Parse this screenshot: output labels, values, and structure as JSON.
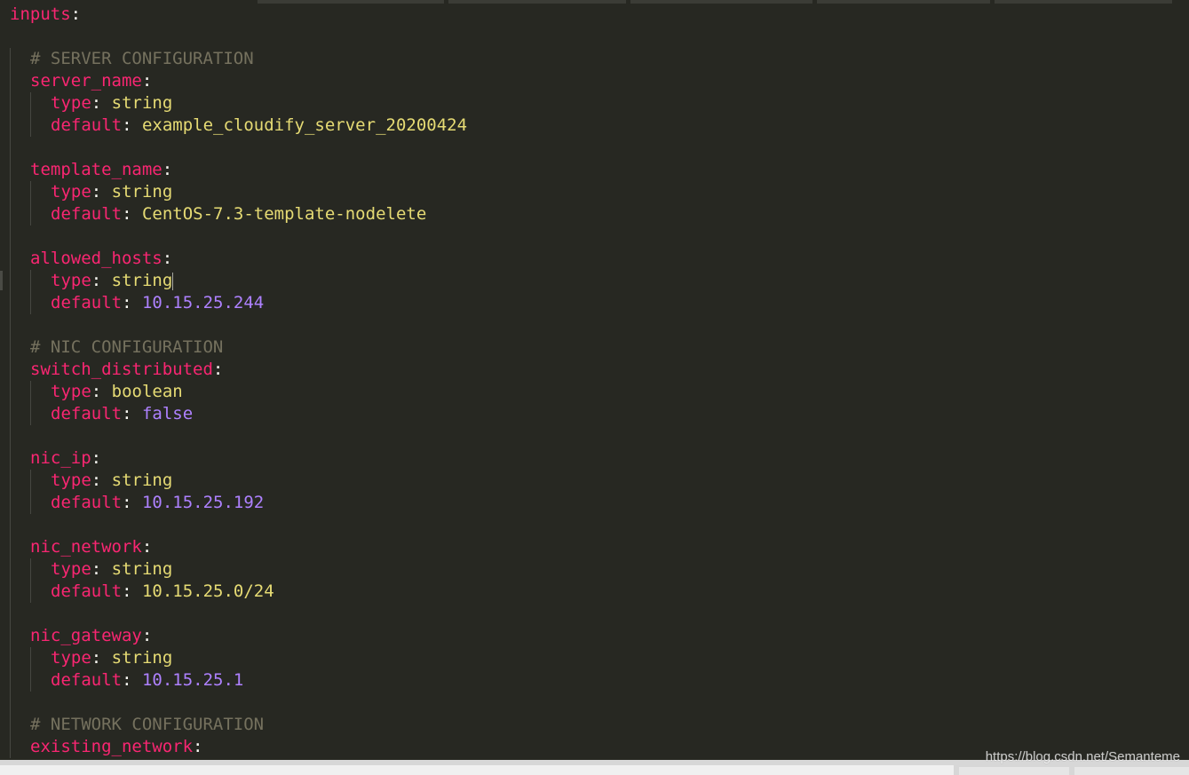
{
  "editor": {
    "lines": [
      {
        "indent": 0,
        "key": "inputs",
        "colon": ":"
      },
      {
        "indent": 0,
        "blank": true
      },
      {
        "indent": 1,
        "comment": "# SERVER CONFIGURATION"
      },
      {
        "indent": 1,
        "key": "server_name",
        "colon": ":"
      },
      {
        "indent": 2,
        "key": "type",
        "colon": ": ",
        "value": "string",
        "vtype": "str"
      },
      {
        "indent": 2,
        "key": "default",
        "colon": ": ",
        "value": "example_cloudify_server_20200424",
        "vtype": "str"
      },
      {
        "indent": 1,
        "blank": true
      },
      {
        "indent": 1,
        "key": "template_name",
        "colon": ":"
      },
      {
        "indent": 2,
        "key": "type",
        "colon": ": ",
        "value": "string",
        "vtype": "str"
      },
      {
        "indent": 2,
        "key": "default",
        "colon": ": ",
        "value": "CentOS-7.3-template-nodelete",
        "vtype": "str"
      },
      {
        "indent": 1,
        "blank": true
      },
      {
        "indent": 1,
        "key": "allowed_hosts",
        "colon": ":"
      },
      {
        "indent": 2,
        "key": "type",
        "colon": ": ",
        "value": "string",
        "vtype": "str",
        "caret": true
      },
      {
        "indent": 2,
        "key": "default",
        "colon": ": ",
        "value": "10.15.25.244",
        "vtype": "num"
      },
      {
        "indent": 1,
        "blank": true
      },
      {
        "indent": 1,
        "comment": "# NIC CONFIGURATION"
      },
      {
        "indent": 1,
        "key": "switch_distributed",
        "colon": ":"
      },
      {
        "indent": 2,
        "key": "type",
        "colon": ": ",
        "value": "boolean",
        "vtype": "str"
      },
      {
        "indent": 2,
        "key": "default",
        "colon": ": ",
        "value": "false",
        "vtype": "num"
      },
      {
        "indent": 1,
        "blank": true
      },
      {
        "indent": 1,
        "key": "nic_ip",
        "colon": ":"
      },
      {
        "indent": 2,
        "key": "type",
        "colon": ": ",
        "value": "string",
        "vtype": "str"
      },
      {
        "indent": 2,
        "key": "default",
        "colon": ": ",
        "value": "10.15.25.192",
        "vtype": "num"
      },
      {
        "indent": 1,
        "blank": true
      },
      {
        "indent": 1,
        "key": "nic_network",
        "colon": ":"
      },
      {
        "indent": 2,
        "key": "type",
        "colon": ": ",
        "value": "string",
        "vtype": "str"
      },
      {
        "indent": 2,
        "key": "default",
        "colon": ": ",
        "value": "10.15.25.0/24",
        "vtype": "str"
      },
      {
        "indent": 1,
        "blank": true
      },
      {
        "indent": 1,
        "key": "nic_gateway",
        "colon": ":"
      },
      {
        "indent": 2,
        "key": "type",
        "colon": ": ",
        "value": "string",
        "vtype": "str"
      },
      {
        "indent": 2,
        "key": "default",
        "colon": ": ",
        "value": "10.15.25.1",
        "vtype": "num"
      },
      {
        "indent": 1,
        "blank": true
      },
      {
        "indent": 1,
        "comment": "# NETWORK CONFIGURATION"
      },
      {
        "indent": 1,
        "key": "existing_network",
        "colon": ":"
      }
    ]
  },
  "watermark": "https://blog.csdn.net/Semanteme",
  "colors": {
    "background": "#272822",
    "key": "#f92672",
    "string": "#e6db74",
    "number": "#ae81ff",
    "comment": "#75715e",
    "text": "#f8f8f2"
  }
}
